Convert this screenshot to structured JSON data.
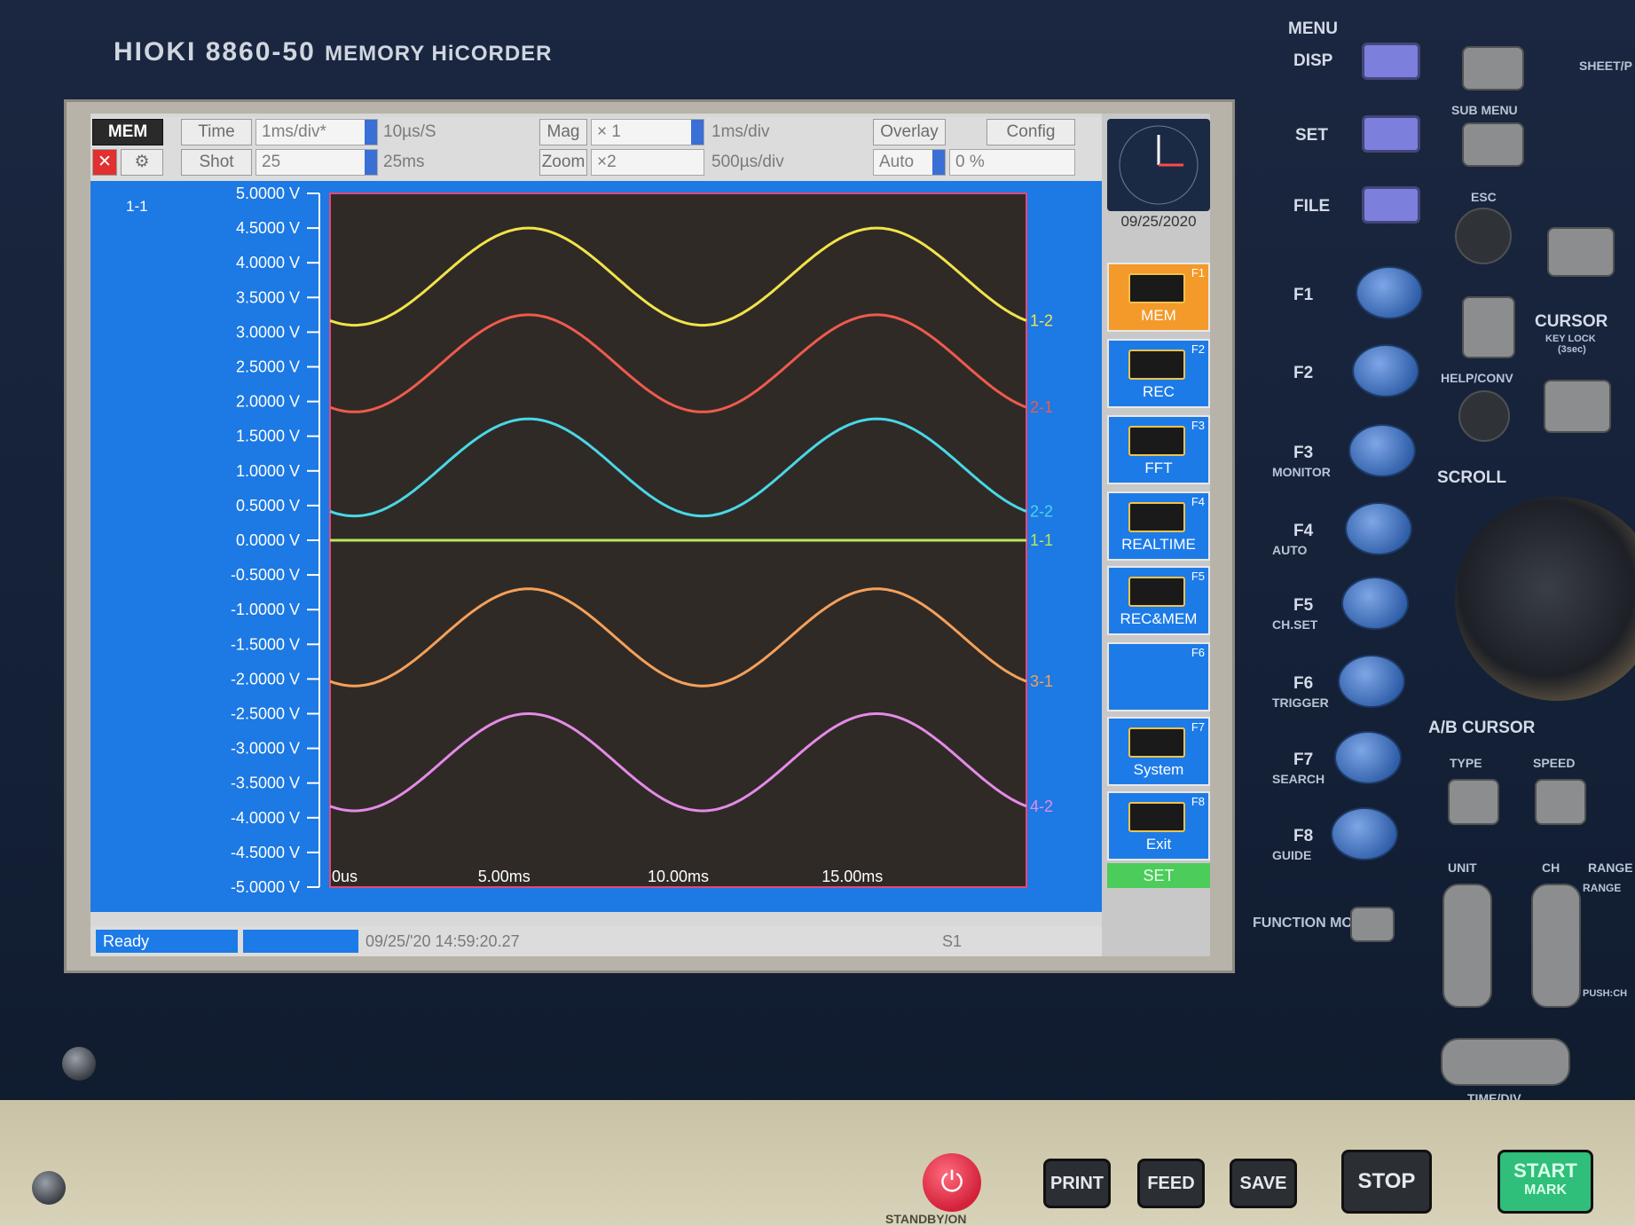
{
  "device": {
    "brand": "HIOKI",
    "model": "8860-50",
    "subtitle": "MEMORY HiCORDER"
  },
  "toolbar": {
    "mode": "MEM",
    "time_label": "Time",
    "time_div": "1ms/div*",
    "sample_rate": "10µs/S",
    "mag_label": "Mag",
    "mag_value": "× 1",
    "mag_div": "1ms/div",
    "overlay": "Overlay",
    "config": "Config",
    "shot_label": "Shot",
    "shot_value": "25",
    "shot_time": "25ms",
    "zoom_label": "Zoom",
    "zoom_value": "×2",
    "zoom_div": "500µs/div",
    "trigger_mode": "Auto",
    "trigger_pct": "0 %"
  },
  "plot": {
    "channel_label": "1-1",
    "background": "#2f2a26",
    "frame_color": "#e8467a"
  },
  "chart_data": {
    "type": "line",
    "x_unit": "ms",
    "xlim": [
      0,
      20
    ],
    "ylim": [
      -5,
      5
    ],
    "y_ticks": [
      "5.0000 V",
      "4.5000 V",
      "4.0000 V",
      "3.5000 V",
      "3.0000 V",
      "2.5000 V",
      "2.0000 V",
      "1.5000 V",
      "1.0000 V",
      "0.5000 V",
      "0.0000 V",
      "-0.5000 V",
      "-1.0000 V",
      "-1.5000 V",
      "-2.0000 V",
      "-2.5000 V",
      "-3.0000 V",
      "-3.5000 V",
      "-4.0000 V",
      "-4.5000 V",
      "-5.0000 V"
    ],
    "y_tick_values": [
      5,
      4.5,
      4,
      3.5,
      3,
      2.5,
      2,
      1.5,
      1,
      0.5,
      0,
      -0.5,
      -1,
      -1.5,
      -2,
      -2.5,
      -3,
      -3.5,
      -4,
      -4.5,
      -5
    ],
    "x_ticks": [
      "0us",
      "5.00ms",
      "10.00ms",
      "15.00ms"
    ],
    "x_tick_values": [
      0,
      5,
      10,
      15
    ],
    "series": [
      {
        "name": "1-2",
        "color": "#f2e34a",
        "type": "sine",
        "offset": 3.8,
        "amplitude": 0.7,
        "period_ms": 10,
        "peak_ms": 5.7
      },
      {
        "name": "2-1",
        "color": "#ef5a4e",
        "type": "sine",
        "offset": 2.55,
        "amplitude": 0.7,
        "period_ms": 10,
        "peak_ms": 5.7
      },
      {
        "name": "2-2",
        "color": "#49d7e6",
        "type": "sine",
        "offset": 1.05,
        "amplitude": 0.7,
        "period_ms": 10,
        "peak_ms": 5.7
      },
      {
        "name": "1-1",
        "color": "#b9e85a",
        "type": "flat",
        "offset": 0.0
      },
      {
        "name": "3-1",
        "color": "#f5a05a",
        "type": "sine",
        "offset": -1.4,
        "amplitude": 0.7,
        "period_ms": 10,
        "peak_ms": 5.7
      },
      {
        "name": "4-2",
        "color": "#e58ae8",
        "type": "sine",
        "offset": -3.2,
        "amplitude": 0.7,
        "period_ms": 10,
        "peak_ms": 5.7
      }
    ]
  },
  "fkeys": {
    "date": "09/25/2020",
    "items": [
      {
        "num": "F1",
        "label": "MEM"
      },
      {
        "num": "F2",
        "label": "REC"
      },
      {
        "num": "F3",
        "label": "FFT"
      },
      {
        "num": "F4",
        "label": "REALTIME"
      },
      {
        "num": "F5",
        "label": "REC&MEM"
      },
      {
        "num": "F6",
        "label": ""
      },
      {
        "num": "F7",
        "label": "System"
      },
      {
        "num": "F8",
        "label": "Exit"
      }
    ],
    "set": "SET"
  },
  "status": {
    "ready": "Ready",
    "timestamp": "09/25/'20 14:59:20.27",
    "s1": "S1"
  },
  "panel": {
    "menu": "MENU",
    "disp": "DISP",
    "set": "SET",
    "file": "FILE",
    "sub_menu": "SUB MENU",
    "sheet": "SHEET/P",
    "esc": "ESC",
    "cursor": "CURSOR",
    "key_lock": "KEY LOCK",
    "key_lock_sub": "(3sec)",
    "help": "HELP/CONV",
    "scroll": "SCROLL",
    "ab_cursor": "A/B CURSOR",
    "type": "TYPE",
    "speed": "SPEED",
    "unit": "UNIT",
    "ch": "CH",
    "range": "RANGE",
    "range2": "RANGE",
    "push_ch": "PUSH:CH",
    "time_div": "TIME/DIV",
    "function_mode": "FUNCTION MODE",
    "f_labels": [
      {
        "key": "F1",
        "sub": ""
      },
      {
        "key": "F2",
        "sub": ""
      },
      {
        "key": "F3",
        "sub": "MONITOR"
      },
      {
        "key": "F4",
        "sub": "AUTO"
      },
      {
        "key": "F5",
        "sub": "CH.SET"
      },
      {
        "key": "F6",
        "sub": "TRIGGER"
      },
      {
        "key": "F7",
        "sub": "SEARCH"
      },
      {
        "key": "F8",
        "sub": "GUIDE"
      }
    ]
  },
  "hardware": {
    "print": "PRINT",
    "feed": "FEED",
    "save": "SAVE",
    "stop": "STOP",
    "start": "START",
    "mark": "MARK",
    "standby": "STANDBY/ON"
  }
}
